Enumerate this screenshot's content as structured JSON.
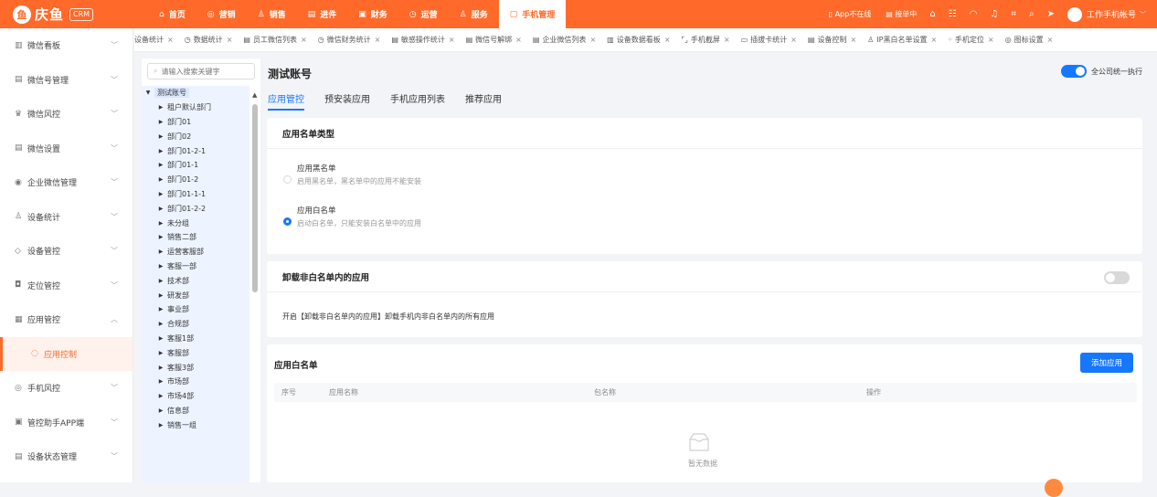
{
  "app": {
    "name": "庆鱼",
    "badge": "CRM",
    "logo_glyph": "鱼"
  },
  "nav": [
    {
      "icon": "⌂",
      "label": "首页"
    },
    {
      "icon": "◎",
      "label": "营销"
    },
    {
      "icon": "♙",
      "label": "销售"
    },
    {
      "icon": "▤",
      "label": "进件"
    },
    {
      "icon": "▣",
      "label": "财务"
    },
    {
      "icon": "◷",
      "label": "运营"
    },
    {
      "icon": "♙",
      "label": "服务"
    },
    {
      "icon": "▢",
      "label": "手机管理"
    }
  ],
  "topright": {
    "app_status": "App不在线",
    "task": "接单中",
    "user": "工作手机帐号"
  },
  "sidebar": [
    {
      "icon": "▥",
      "label": "微信看板"
    },
    {
      "icon": "▤",
      "label": "微信号管理"
    },
    {
      "icon": "♛",
      "label": "微信风控"
    },
    {
      "icon": "▤",
      "label": "微信设置"
    },
    {
      "icon": "◉",
      "label": "企业微信管理"
    },
    {
      "icon": "♙",
      "label": "设备统计"
    },
    {
      "icon": "◇",
      "label": "设备管控"
    },
    {
      "icon": "◘",
      "label": "定位管控"
    },
    {
      "icon": "▦",
      "label": "应用管控"
    },
    {
      "icon": "◌",
      "label": "应用控制"
    },
    {
      "icon": "◎",
      "label": "手机风控"
    },
    {
      "icon": "▣",
      "label": "管控助手APP端"
    },
    {
      "icon": "▤",
      "label": "设备状态管理"
    }
  ],
  "tabs": [
    {
      "icon": "",
      "label": "设备统计"
    },
    {
      "icon": "◷",
      "label": "数据统计"
    },
    {
      "icon": "▤",
      "label": "员工微信列表"
    },
    {
      "icon": "◷",
      "label": "微信财务统计"
    },
    {
      "icon": "▤",
      "label": "敏感操作统计"
    },
    {
      "icon": "▤",
      "label": "微信号解绑"
    },
    {
      "icon": "▤",
      "label": "企业微信列表"
    },
    {
      "icon": "▥",
      "label": "设备数据看板"
    },
    {
      "icon": "⌜⌟",
      "label": "手机截屏"
    },
    {
      "icon": "▭",
      "label": "插拔卡统计"
    },
    {
      "icon": "▤",
      "label": "设备控制"
    },
    {
      "icon": "♙",
      "label": "IP黑白名单设置"
    },
    {
      "icon": "◦",
      "label": "手机定位"
    },
    {
      "icon": "◎",
      "label": "图标设置"
    }
  ],
  "tree": {
    "search_placeholder": "请输入搜索关键字",
    "root": "测试账号",
    "children": [
      "租户默认部门",
      "部门01",
      "部门02",
      "部门01-2-1",
      "部门01-1",
      "部门01-2",
      "部门01-1-1",
      "部门01-2-2",
      "未分组",
      "销售二部",
      "运营客服部",
      "客服一部",
      "技术部",
      "研发部",
      "事业部",
      "合规部",
      "客服1部",
      "客服部",
      "客服3部",
      "市场部",
      "市场4部",
      "信息部",
      "销售一组"
    ]
  },
  "main": {
    "title": "测试账号",
    "toggle_all_label": "全公司统一执行",
    "toggle_all_on": true,
    "subtabs": [
      "应用管控",
      "预安装应用",
      "手机应用列表",
      "推荐应用"
    ],
    "card1": {
      "title": "应用名单类型",
      "options": [
        {
          "title": "应用黑名单",
          "desc": "启用黑名单，黑名单中的应用不能安装",
          "checked": false
        },
        {
          "title": "应用白名单",
          "desc": "启动白名单，只能安装白名单中的应用",
          "checked": true
        }
      ]
    },
    "card2": {
      "title": "卸载非白名单内的应用",
      "desc": "开启【卸载非白名单内的应用】卸载手机内非白名单内的所有应用",
      "enabled": false
    },
    "card3": {
      "title": "应用白名单",
      "add_button": "添加应用",
      "columns": [
        "序号",
        "应用名称",
        "包名称",
        "操作"
      ],
      "empty_text": "暂无数据"
    }
  }
}
